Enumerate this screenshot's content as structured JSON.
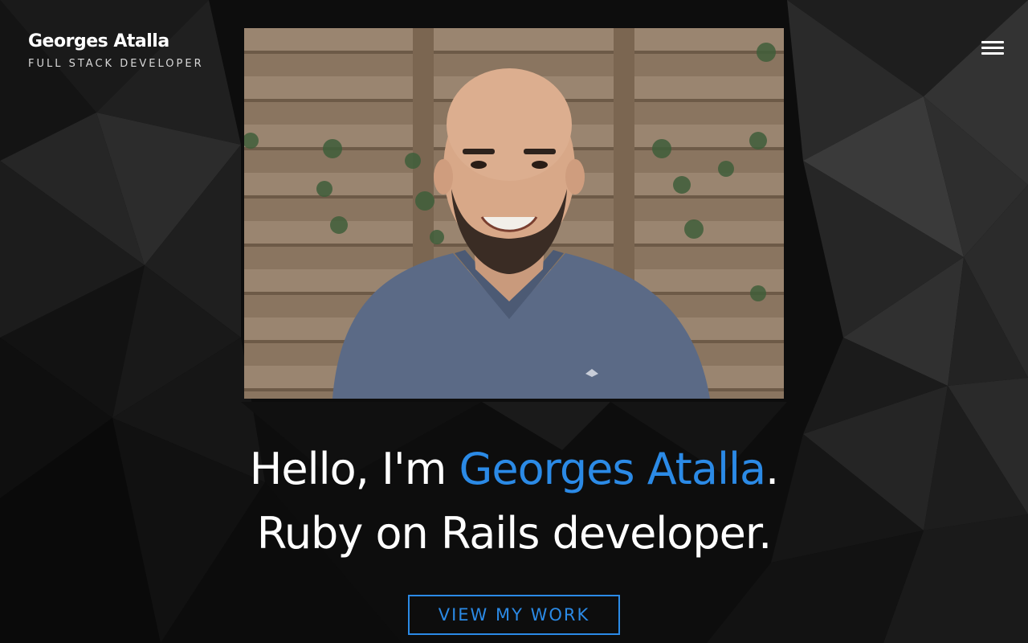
{
  "header": {
    "name": "Georges Atalla",
    "role": "FULL STACK DEVELOPER",
    "menu_icon": "hamburger-menu-icon"
  },
  "hero": {
    "greeting_prefix": "Hello, I'm ",
    "greeting_name": "Georges Atalla",
    "greeting_suffix": ".",
    "tagline": "Ruby on Rails developer.",
    "cta_label": "VIEW MY WORK"
  },
  "colors": {
    "accent": "#2b8ae6",
    "background": "#0b0b0b",
    "text": "#ffffff"
  }
}
